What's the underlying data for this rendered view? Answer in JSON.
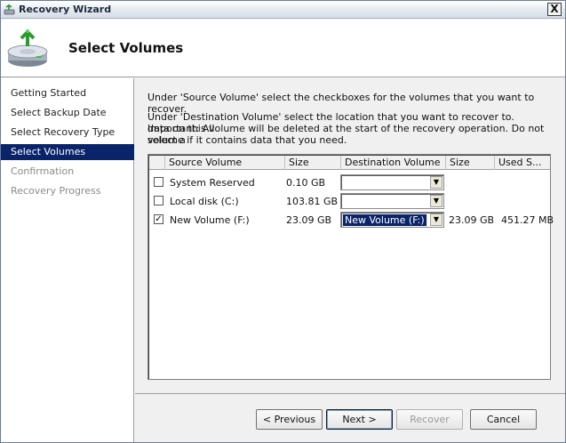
{
  "window": {
    "title": "Recovery Wizard",
    "close_label": "X"
  },
  "header": {
    "title": "Select Volumes"
  },
  "nav": {
    "items": [
      {
        "label": "Getting Started",
        "state": "normal"
      },
      {
        "label": "Select Backup Date",
        "state": "normal"
      },
      {
        "label": "Select Recovery Type",
        "state": "normal"
      },
      {
        "label": "Select Volumes",
        "state": "selected"
      },
      {
        "label": "Confirmation",
        "state": "disabled"
      },
      {
        "label": "Recovery Progress",
        "state": "disabled"
      }
    ]
  },
  "content": {
    "instruction1": "Under 'Source Volume' select the checkboxes for the volumes that you want to recover.",
    "instruction2_line1": "Under 'Destination Volume' select the location that you want to recover to. Important: All",
    "instruction2_line2": "data on this volume will be deleted at the start of the recovery operation. Do not select a",
    "instruction2_line3": "volume if it contains data that you need."
  },
  "table": {
    "columns": [
      "Source Volume",
      "Size",
      "Destination Volume",
      "Size",
      "Used S..."
    ],
    "rows": [
      {
        "checked": false,
        "source": "System Reserved",
        "size": "0.10 GB",
        "destination": "",
        "dest_size": "",
        "used": ""
      },
      {
        "checked": false,
        "source": "Local disk (C:)",
        "size": "103.81 GB",
        "destination": "",
        "dest_size": "",
        "used": ""
      },
      {
        "checked": true,
        "source": "New Volume (F:)",
        "size": "23.09 GB",
        "destination": "New Volume (F:)",
        "dest_size": "23.09 GB",
        "used": "451.27 MB"
      }
    ]
  },
  "buttons": {
    "previous": "< Previous",
    "next": "Next >",
    "recover": "Recover",
    "cancel": "Cancel"
  },
  "icons": {
    "title": "wizard-app-icon",
    "header": "disk-recovery-icon",
    "dropdown": "chevron-down-icon",
    "check": "checkmark-icon"
  },
  "colors": {
    "selection": "#0a246a",
    "window_bg": "#f0f0f0"
  }
}
